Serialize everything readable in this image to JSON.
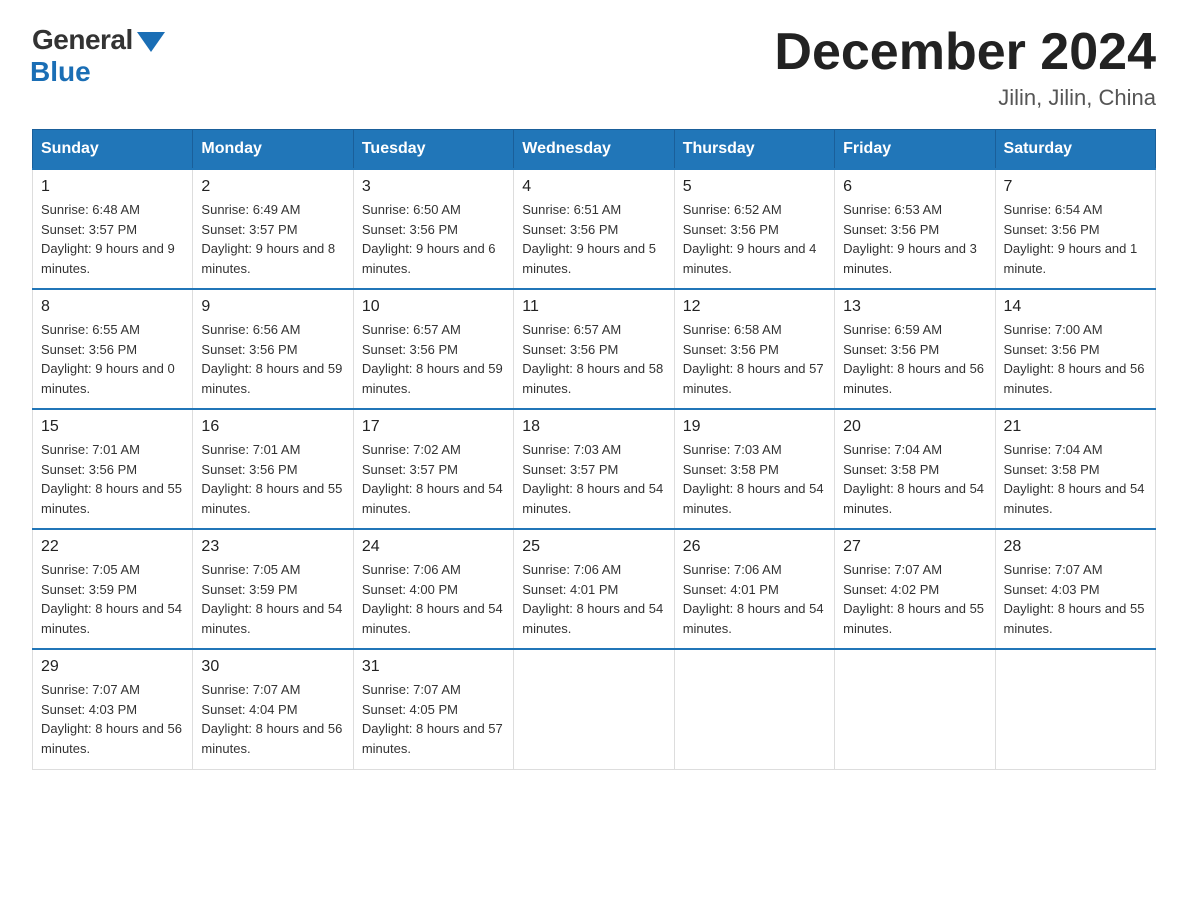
{
  "logo": {
    "general": "General",
    "blue": "Blue"
  },
  "title": "December 2024",
  "subtitle": "Jilin, Jilin, China",
  "days_of_week": [
    "Sunday",
    "Monday",
    "Tuesday",
    "Wednesday",
    "Thursday",
    "Friday",
    "Saturday"
  ],
  "weeks": [
    [
      {
        "day": "1",
        "sunrise": "6:48 AM",
        "sunset": "3:57 PM",
        "daylight": "9 hours and 9 minutes."
      },
      {
        "day": "2",
        "sunrise": "6:49 AM",
        "sunset": "3:57 PM",
        "daylight": "9 hours and 8 minutes."
      },
      {
        "day": "3",
        "sunrise": "6:50 AM",
        "sunset": "3:56 PM",
        "daylight": "9 hours and 6 minutes."
      },
      {
        "day": "4",
        "sunrise": "6:51 AM",
        "sunset": "3:56 PM",
        "daylight": "9 hours and 5 minutes."
      },
      {
        "day": "5",
        "sunrise": "6:52 AM",
        "sunset": "3:56 PM",
        "daylight": "9 hours and 4 minutes."
      },
      {
        "day": "6",
        "sunrise": "6:53 AM",
        "sunset": "3:56 PM",
        "daylight": "9 hours and 3 minutes."
      },
      {
        "day": "7",
        "sunrise": "6:54 AM",
        "sunset": "3:56 PM",
        "daylight": "9 hours and 1 minute."
      }
    ],
    [
      {
        "day": "8",
        "sunrise": "6:55 AM",
        "sunset": "3:56 PM",
        "daylight": "9 hours and 0 minutes."
      },
      {
        "day": "9",
        "sunrise": "6:56 AM",
        "sunset": "3:56 PM",
        "daylight": "8 hours and 59 minutes."
      },
      {
        "day": "10",
        "sunrise": "6:57 AM",
        "sunset": "3:56 PM",
        "daylight": "8 hours and 59 minutes."
      },
      {
        "day": "11",
        "sunrise": "6:57 AM",
        "sunset": "3:56 PM",
        "daylight": "8 hours and 58 minutes."
      },
      {
        "day": "12",
        "sunrise": "6:58 AM",
        "sunset": "3:56 PM",
        "daylight": "8 hours and 57 minutes."
      },
      {
        "day": "13",
        "sunrise": "6:59 AM",
        "sunset": "3:56 PM",
        "daylight": "8 hours and 56 minutes."
      },
      {
        "day": "14",
        "sunrise": "7:00 AM",
        "sunset": "3:56 PM",
        "daylight": "8 hours and 56 minutes."
      }
    ],
    [
      {
        "day": "15",
        "sunrise": "7:01 AM",
        "sunset": "3:56 PM",
        "daylight": "8 hours and 55 minutes."
      },
      {
        "day": "16",
        "sunrise": "7:01 AM",
        "sunset": "3:56 PM",
        "daylight": "8 hours and 55 minutes."
      },
      {
        "day": "17",
        "sunrise": "7:02 AM",
        "sunset": "3:57 PM",
        "daylight": "8 hours and 54 minutes."
      },
      {
        "day": "18",
        "sunrise": "7:03 AM",
        "sunset": "3:57 PM",
        "daylight": "8 hours and 54 minutes."
      },
      {
        "day": "19",
        "sunrise": "7:03 AM",
        "sunset": "3:58 PM",
        "daylight": "8 hours and 54 minutes."
      },
      {
        "day": "20",
        "sunrise": "7:04 AM",
        "sunset": "3:58 PM",
        "daylight": "8 hours and 54 minutes."
      },
      {
        "day": "21",
        "sunrise": "7:04 AM",
        "sunset": "3:58 PM",
        "daylight": "8 hours and 54 minutes."
      }
    ],
    [
      {
        "day": "22",
        "sunrise": "7:05 AM",
        "sunset": "3:59 PM",
        "daylight": "8 hours and 54 minutes."
      },
      {
        "day": "23",
        "sunrise": "7:05 AM",
        "sunset": "3:59 PM",
        "daylight": "8 hours and 54 minutes."
      },
      {
        "day": "24",
        "sunrise": "7:06 AM",
        "sunset": "4:00 PM",
        "daylight": "8 hours and 54 minutes."
      },
      {
        "day": "25",
        "sunrise": "7:06 AM",
        "sunset": "4:01 PM",
        "daylight": "8 hours and 54 minutes."
      },
      {
        "day": "26",
        "sunrise": "7:06 AM",
        "sunset": "4:01 PM",
        "daylight": "8 hours and 54 minutes."
      },
      {
        "day": "27",
        "sunrise": "7:07 AM",
        "sunset": "4:02 PM",
        "daylight": "8 hours and 55 minutes."
      },
      {
        "day": "28",
        "sunrise": "7:07 AM",
        "sunset": "4:03 PM",
        "daylight": "8 hours and 55 minutes."
      }
    ],
    [
      {
        "day": "29",
        "sunrise": "7:07 AM",
        "sunset": "4:03 PM",
        "daylight": "8 hours and 56 minutes."
      },
      {
        "day": "30",
        "sunrise": "7:07 AM",
        "sunset": "4:04 PM",
        "daylight": "8 hours and 56 minutes."
      },
      {
        "day": "31",
        "sunrise": "7:07 AM",
        "sunset": "4:05 PM",
        "daylight": "8 hours and 57 minutes."
      },
      null,
      null,
      null,
      null
    ]
  ],
  "labels": {
    "sunrise": "Sunrise:",
    "sunset": "Sunset:",
    "daylight": "Daylight:"
  }
}
